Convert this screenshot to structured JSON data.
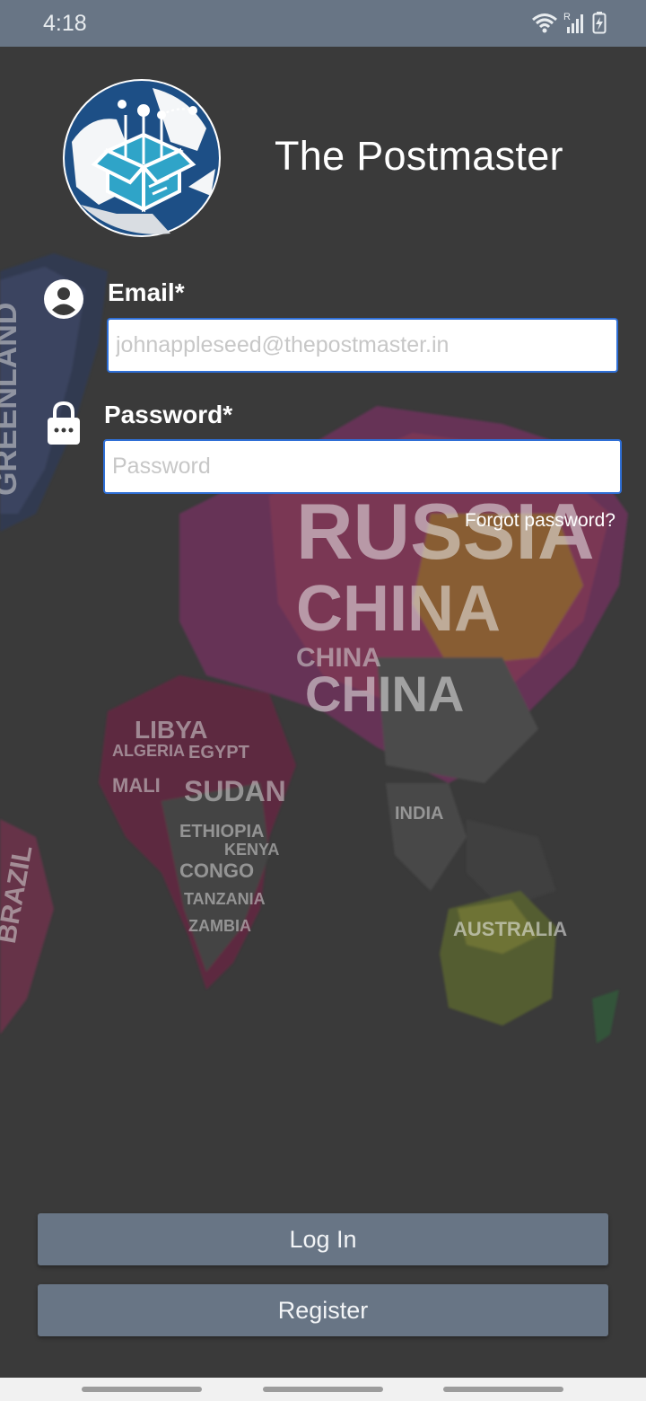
{
  "status_bar": {
    "time": "4:18",
    "network_letter": "R"
  },
  "header": {
    "app_title": "The Postmaster"
  },
  "form": {
    "email_label": "Email*",
    "email_placeholder": "johnappleseed@thepostmaster.in",
    "email_value": "",
    "password_label": "Password*",
    "password_placeholder": "Password",
    "password_value": "",
    "forgot_password": "Forgot password?"
  },
  "background_map_words": [
    "GREENLAND",
    "RUSSIA",
    "CHINA",
    "LIBYA",
    "ALGERIA",
    "MALI",
    "EGYPT",
    "SUDAN",
    "ETHIOPIA",
    "KENYA",
    "CONGO",
    "TANZANIA",
    "ZAMBIA",
    "AUSTRALIA",
    "BRAZIL",
    "INDIA"
  ],
  "actions": {
    "login_label": "Log In",
    "register_label": "Register"
  },
  "colors": {
    "status_bar": "#687585",
    "background": "#3a3a3a",
    "button": "#687585",
    "input_border": "#2f6fd6",
    "logo_blue": "#1d4f86"
  },
  "icons": {
    "email_field": "user-circle-icon",
    "password_field": "lock-icon"
  }
}
